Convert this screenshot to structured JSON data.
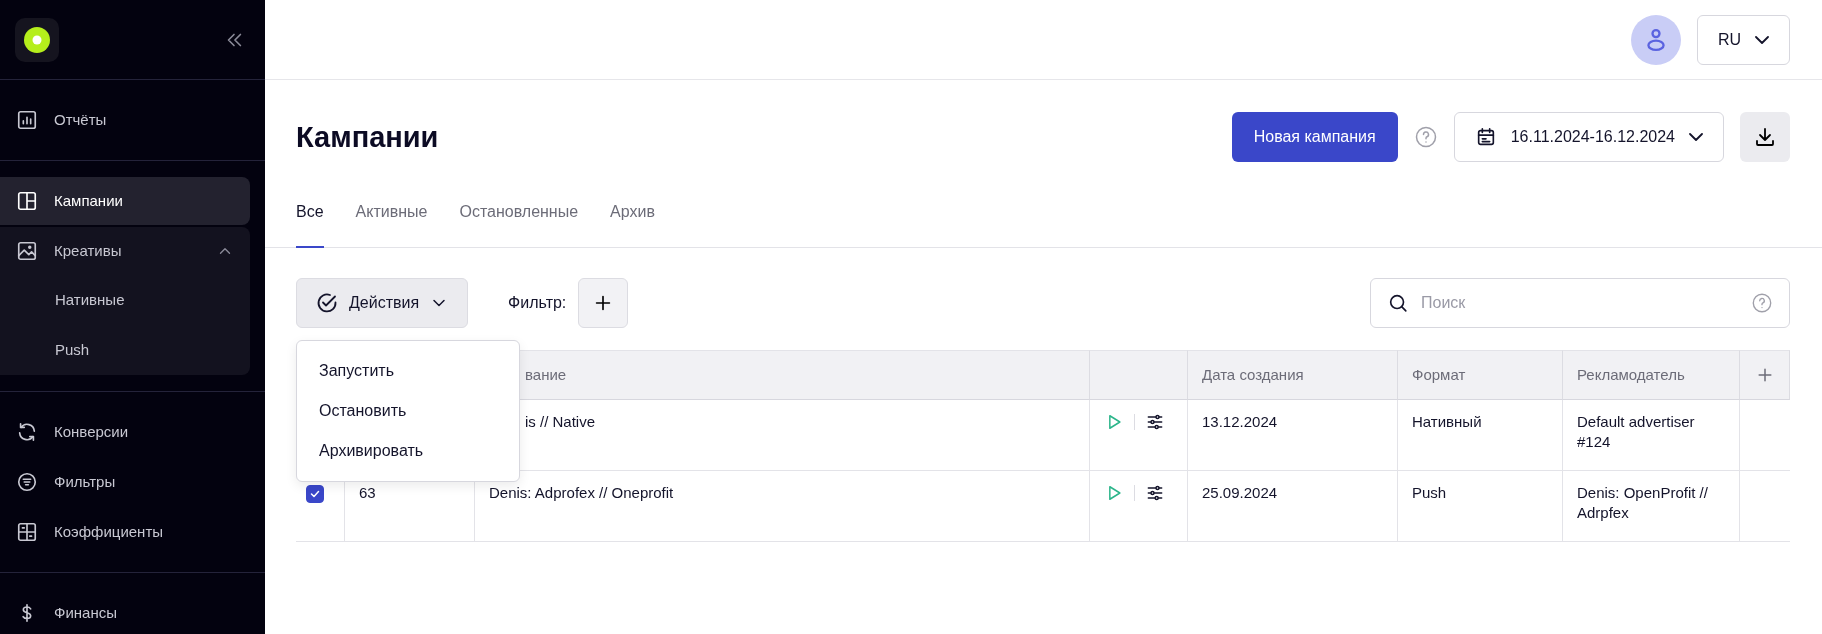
{
  "sidebar": {
    "sections": [
      [
        {
          "label": "Отчёты",
          "selected": false
        }
      ],
      [
        {
          "label": "Кампании",
          "selected": true
        },
        {
          "label": "Креативы",
          "selected": false,
          "expanded": true,
          "children": [
            {
              "label": "Нативные",
              "selected": false
            },
            {
              "label": "Push",
              "selected": false
            }
          ]
        }
      ],
      [
        {
          "label": "Конверсии",
          "selected": false
        },
        {
          "label": "Фильтры",
          "selected": false
        },
        {
          "label": "Коэффициенты",
          "selected": false
        }
      ],
      [
        {
          "label": "Финансы",
          "selected": false
        }
      ]
    ]
  },
  "topbar": {
    "language": "RU"
  },
  "page": {
    "title": "Кампании",
    "new_button": "Новая кампания",
    "date_range": "16.11.2024-16.12.2024"
  },
  "tabs": [
    {
      "label": "Все",
      "selected": true
    },
    {
      "label": "Активные",
      "selected": false
    },
    {
      "label": "Остановленные",
      "selected": false
    },
    {
      "label": "Архив",
      "selected": false
    }
  ],
  "toolbar": {
    "actions_button": "Действия",
    "expanded": true,
    "filter_label": "Фильтр:",
    "search": {
      "placeholder": "Поиск"
    }
  },
  "actions_menu": [
    "Запустить",
    "Остановить",
    "Архивировать"
  ],
  "table": {
    "columns": [
      "вание",
      "Дата создания",
      "Формат",
      "Рекламодатель"
    ],
    "rows": [
      {
        "name": "is // Native",
        "date": "13.12.2024",
        "format": "Нативный",
        "advertiser": "Default advertiser #124"
      },
      {
        "checked": true,
        "id": "63",
        "name": "Denis: Adprofex // Oneprofit",
        "date": "25.09.2024",
        "format": "Push",
        "advertiser": "Denis: OpenProfit // Adrpfex"
      }
    ]
  }
}
